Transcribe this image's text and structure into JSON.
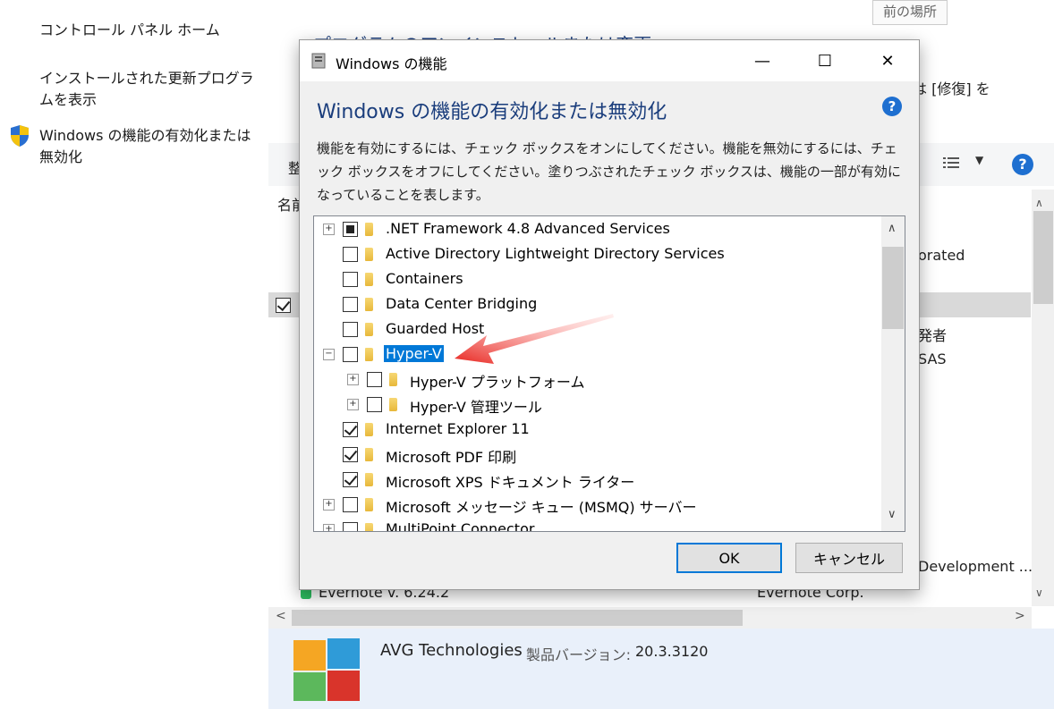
{
  "left_panel": {
    "home": "コントロール パネル ホーム",
    "updates": "インストールされた更新プログラムを表示",
    "features": "Windows の機能の有効化または無効化"
  },
  "background": {
    "title": "プログラムのアンインストールまたは変更",
    "back_tooltip": "前の場所",
    "repair_text": "は [修復] を",
    "col_name_fragment": "名前",
    "toolbar_fragment": "整",
    "rows_right": [
      "orated",
      "発者",
      "SAS",
      "Development ...",
      "Evernote Corp."
    ],
    "evernote_name": "Evernote v. 6.24.2",
    "status_company": "AVG Technologies",
    "status_version_label": "製品バージョン:",
    "status_version": "20.3.3120"
  },
  "dialog": {
    "title": "Windows の機能",
    "heading": "Windows の機能の有効化または無効化",
    "description": "機能を有効にするには、チェック ボックスをオンにしてください。機能を無効にするには、チェック ボックスをオフにしてください。塗りつぶされたチェック ボックスは、機能の一部が有効になっていることを表します。",
    "features": [
      {
        "label": ".NET Framework 4.8 Advanced Services",
        "state": "partial",
        "expander": "+"
      },
      {
        "label": "Active Directory Lightweight Directory Services",
        "state": "unchecked",
        "expander": ""
      },
      {
        "label": "Containers",
        "state": "unchecked",
        "expander": ""
      },
      {
        "label": "Data Center Bridging",
        "state": "unchecked",
        "expander": ""
      },
      {
        "label": "Guarded Host",
        "state": "unchecked",
        "expander": ""
      },
      {
        "label": "Hyper-V",
        "state": "unchecked",
        "expander": "−",
        "selected": true
      },
      {
        "label": "Hyper-V プラットフォーム",
        "state": "unchecked",
        "expander": "+",
        "indent": 1
      },
      {
        "label": "Hyper-V 管理ツール",
        "state": "unchecked",
        "expander": "+",
        "indent": 1
      },
      {
        "label": "Internet Explorer 11",
        "state": "checked",
        "expander": ""
      },
      {
        "label": "Microsoft PDF 印刷",
        "state": "checked",
        "expander": ""
      },
      {
        "label": "Microsoft XPS ドキュメント ライター",
        "state": "checked",
        "expander": ""
      },
      {
        "label": "Microsoft メッセージ キュー (MSMQ) サーバー",
        "state": "unchecked",
        "expander": "+"
      },
      {
        "label": "MultiPoint Connector",
        "state": "unchecked",
        "expander": "+"
      }
    ],
    "ok": "OK",
    "cancel": "キャンセル"
  },
  "colors": {
    "accent": "#0078d7",
    "selection": "#0078d7",
    "arrow": "#e8251f",
    "heading": "#1a3d7c"
  }
}
